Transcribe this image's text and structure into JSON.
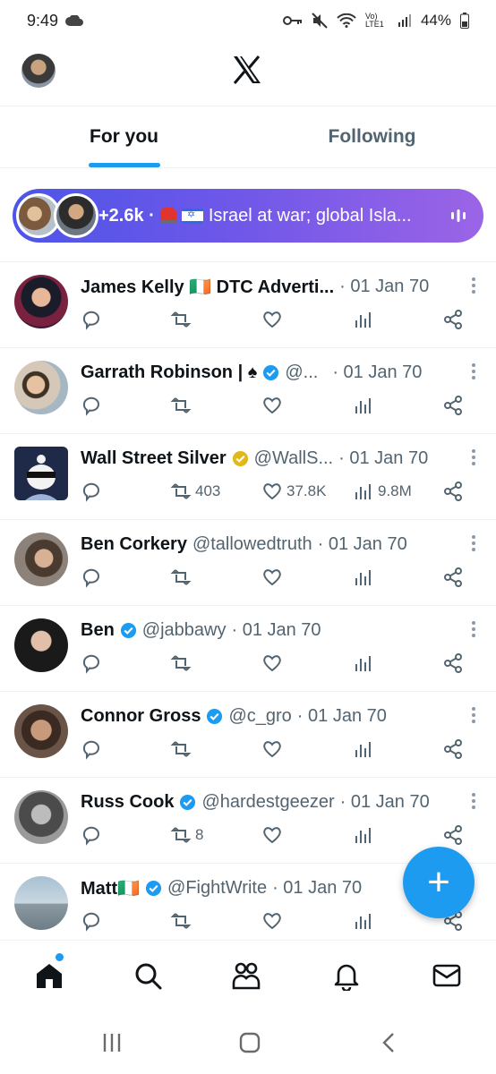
{
  "status_bar": {
    "time": "9:49",
    "network_label": "Vo) LTE1",
    "battery": "44%"
  },
  "tabs": [
    {
      "label": "For you",
      "active": true
    },
    {
      "label": "Following",
      "active": false
    }
  ],
  "live_banner": {
    "count": "+2.6k ·",
    "text": "Israel at war; global Isla..."
  },
  "posts": [
    {
      "name": "James Kelly 🇮🇪 DTC Adverti...",
      "handle": "",
      "date": "· 01 Jan 70",
      "verified": false,
      "reposts": "",
      "likes": "",
      "views": ""
    },
    {
      "name": "Garrath Robinson | ♠",
      "handle": "@...",
      "date": "· 01 Jan 70",
      "verified": "blue",
      "reposts": "",
      "likes": "",
      "views": ""
    },
    {
      "name": "Wall Street Silver",
      "handle": "@WallS...",
      "date": "· 01 Jan 70",
      "verified": "gold",
      "reposts": "403",
      "likes": "37.8K",
      "views": "9.8M"
    },
    {
      "name": "Ben Corkery",
      "handle": "@tallowedtruth",
      "date": "· 01 Jan 70",
      "verified": false,
      "reposts": "",
      "likes": "",
      "views": ""
    },
    {
      "name": "Ben",
      "handle": "@jabbawy",
      "date": "· 01 Jan 70",
      "verified": "blue",
      "reposts": "",
      "likes": "",
      "views": ""
    },
    {
      "name": "Connor Gross",
      "handle": "@c_gro",
      "date": "· 01 Jan 70",
      "verified": "blue",
      "reposts": "",
      "likes": "",
      "views": ""
    },
    {
      "name": "Russ Cook",
      "handle": "@hardestgeezer",
      "date": "· 01 Jan 70",
      "verified": "blue",
      "reposts": "8",
      "likes": "",
      "views": ""
    },
    {
      "name": "Matt🇮🇪",
      "handle": "@FightWrite",
      "date": "· 01 Jan 70",
      "verified": "blue",
      "reposts": "",
      "likes": "",
      "views": ""
    }
  ],
  "fab_label": "+",
  "colors": {
    "accent": "#1d9bf0",
    "gold_badge": "#e2b719",
    "secondary_text": "#536471"
  },
  "icons": {
    "nav": [
      "home-icon",
      "search-icon",
      "communities-icon",
      "notifications-icon",
      "messages-icon"
    ],
    "post_actions": [
      "reply-icon",
      "repost-icon",
      "like-icon",
      "views-icon",
      "share-icon"
    ]
  }
}
